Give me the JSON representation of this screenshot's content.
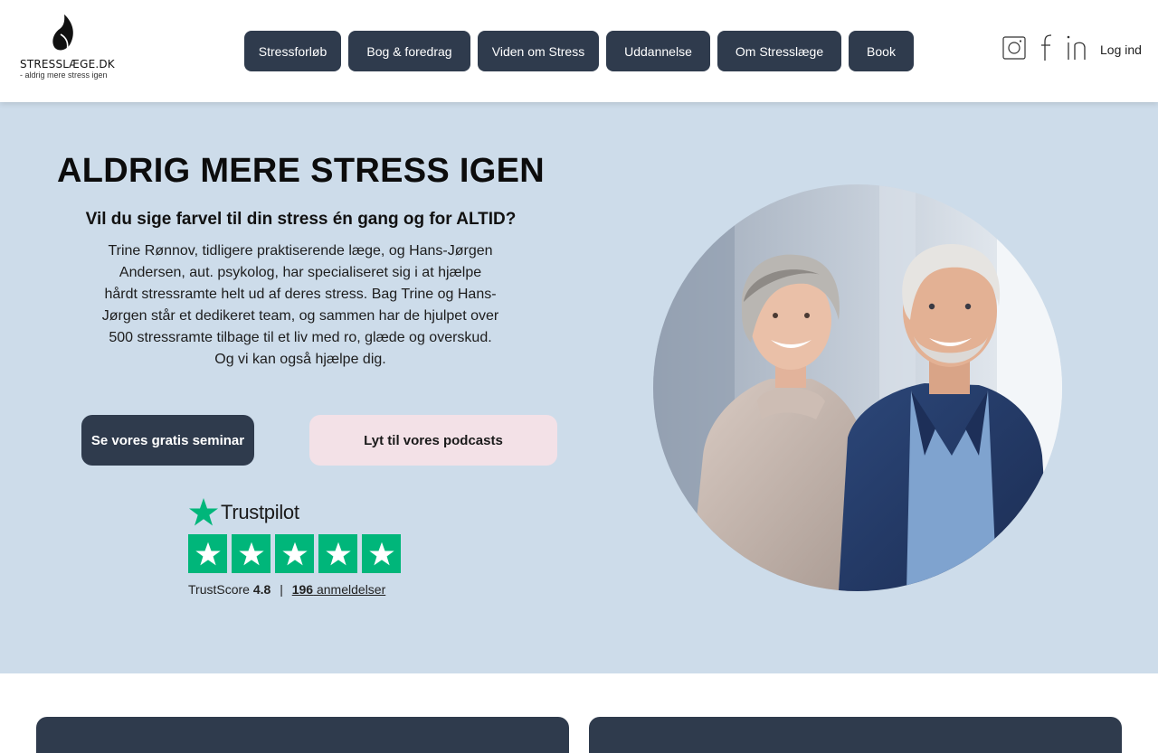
{
  "header": {
    "logo": {
      "text": "STRESSLÆGE.DK",
      "tagline": "- aldrig mere stress igen"
    },
    "nav": [
      "Stressforløb",
      "Bog & foredrag",
      "Viden om Stress",
      "Uddannelse",
      "Om Stresslæge",
      "Book"
    ],
    "social_icons": [
      "instagram-icon",
      "facebook-icon",
      "linkedin-icon"
    ],
    "login_label": "Log ind"
  },
  "hero": {
    "title": "ALDRIG MERE STRESS IGEN",
    "subtitle": "Vil du sige farvel til din stress én gang og for ALTID?",
    "body": "Trine Rønnov, tidligere praktiserende læge, og Hans-Jørgen Andersen, aut. psykolog, har specialiseret sig i at hjælpe hårdt stressramte helt ud af deres stress. Bag Trine og Hans-Jørgen står et dedikeret team, og sammen har de hjulpet over 500 stressramte tilbage til et liv med ro, glæde og overskud. Og vi kan også hjælpe dig.",
    "cta_primary": "Se vores gratis seminar",
    "cta_secondary": "Lyt til vores podcasts"
  },
  "trustpilot": {
    "brand": "Trustpilot",
    "score_label": "TrustScore",
    "score": "4.8",
    "separator": "|",
    "review_count": "196",
    "review_label": "anmeldelser",
    "stars": 5
  },
  "colors": {
    "header_bg": "#ffffff",
    "nav_button_bg": "#2f3b4d",
    "hero_bg": "#cddcea",
    "cta_secondary_bg": "#f3e1e7",
    "trustpilot_green": "#00b67a"
  }
}
